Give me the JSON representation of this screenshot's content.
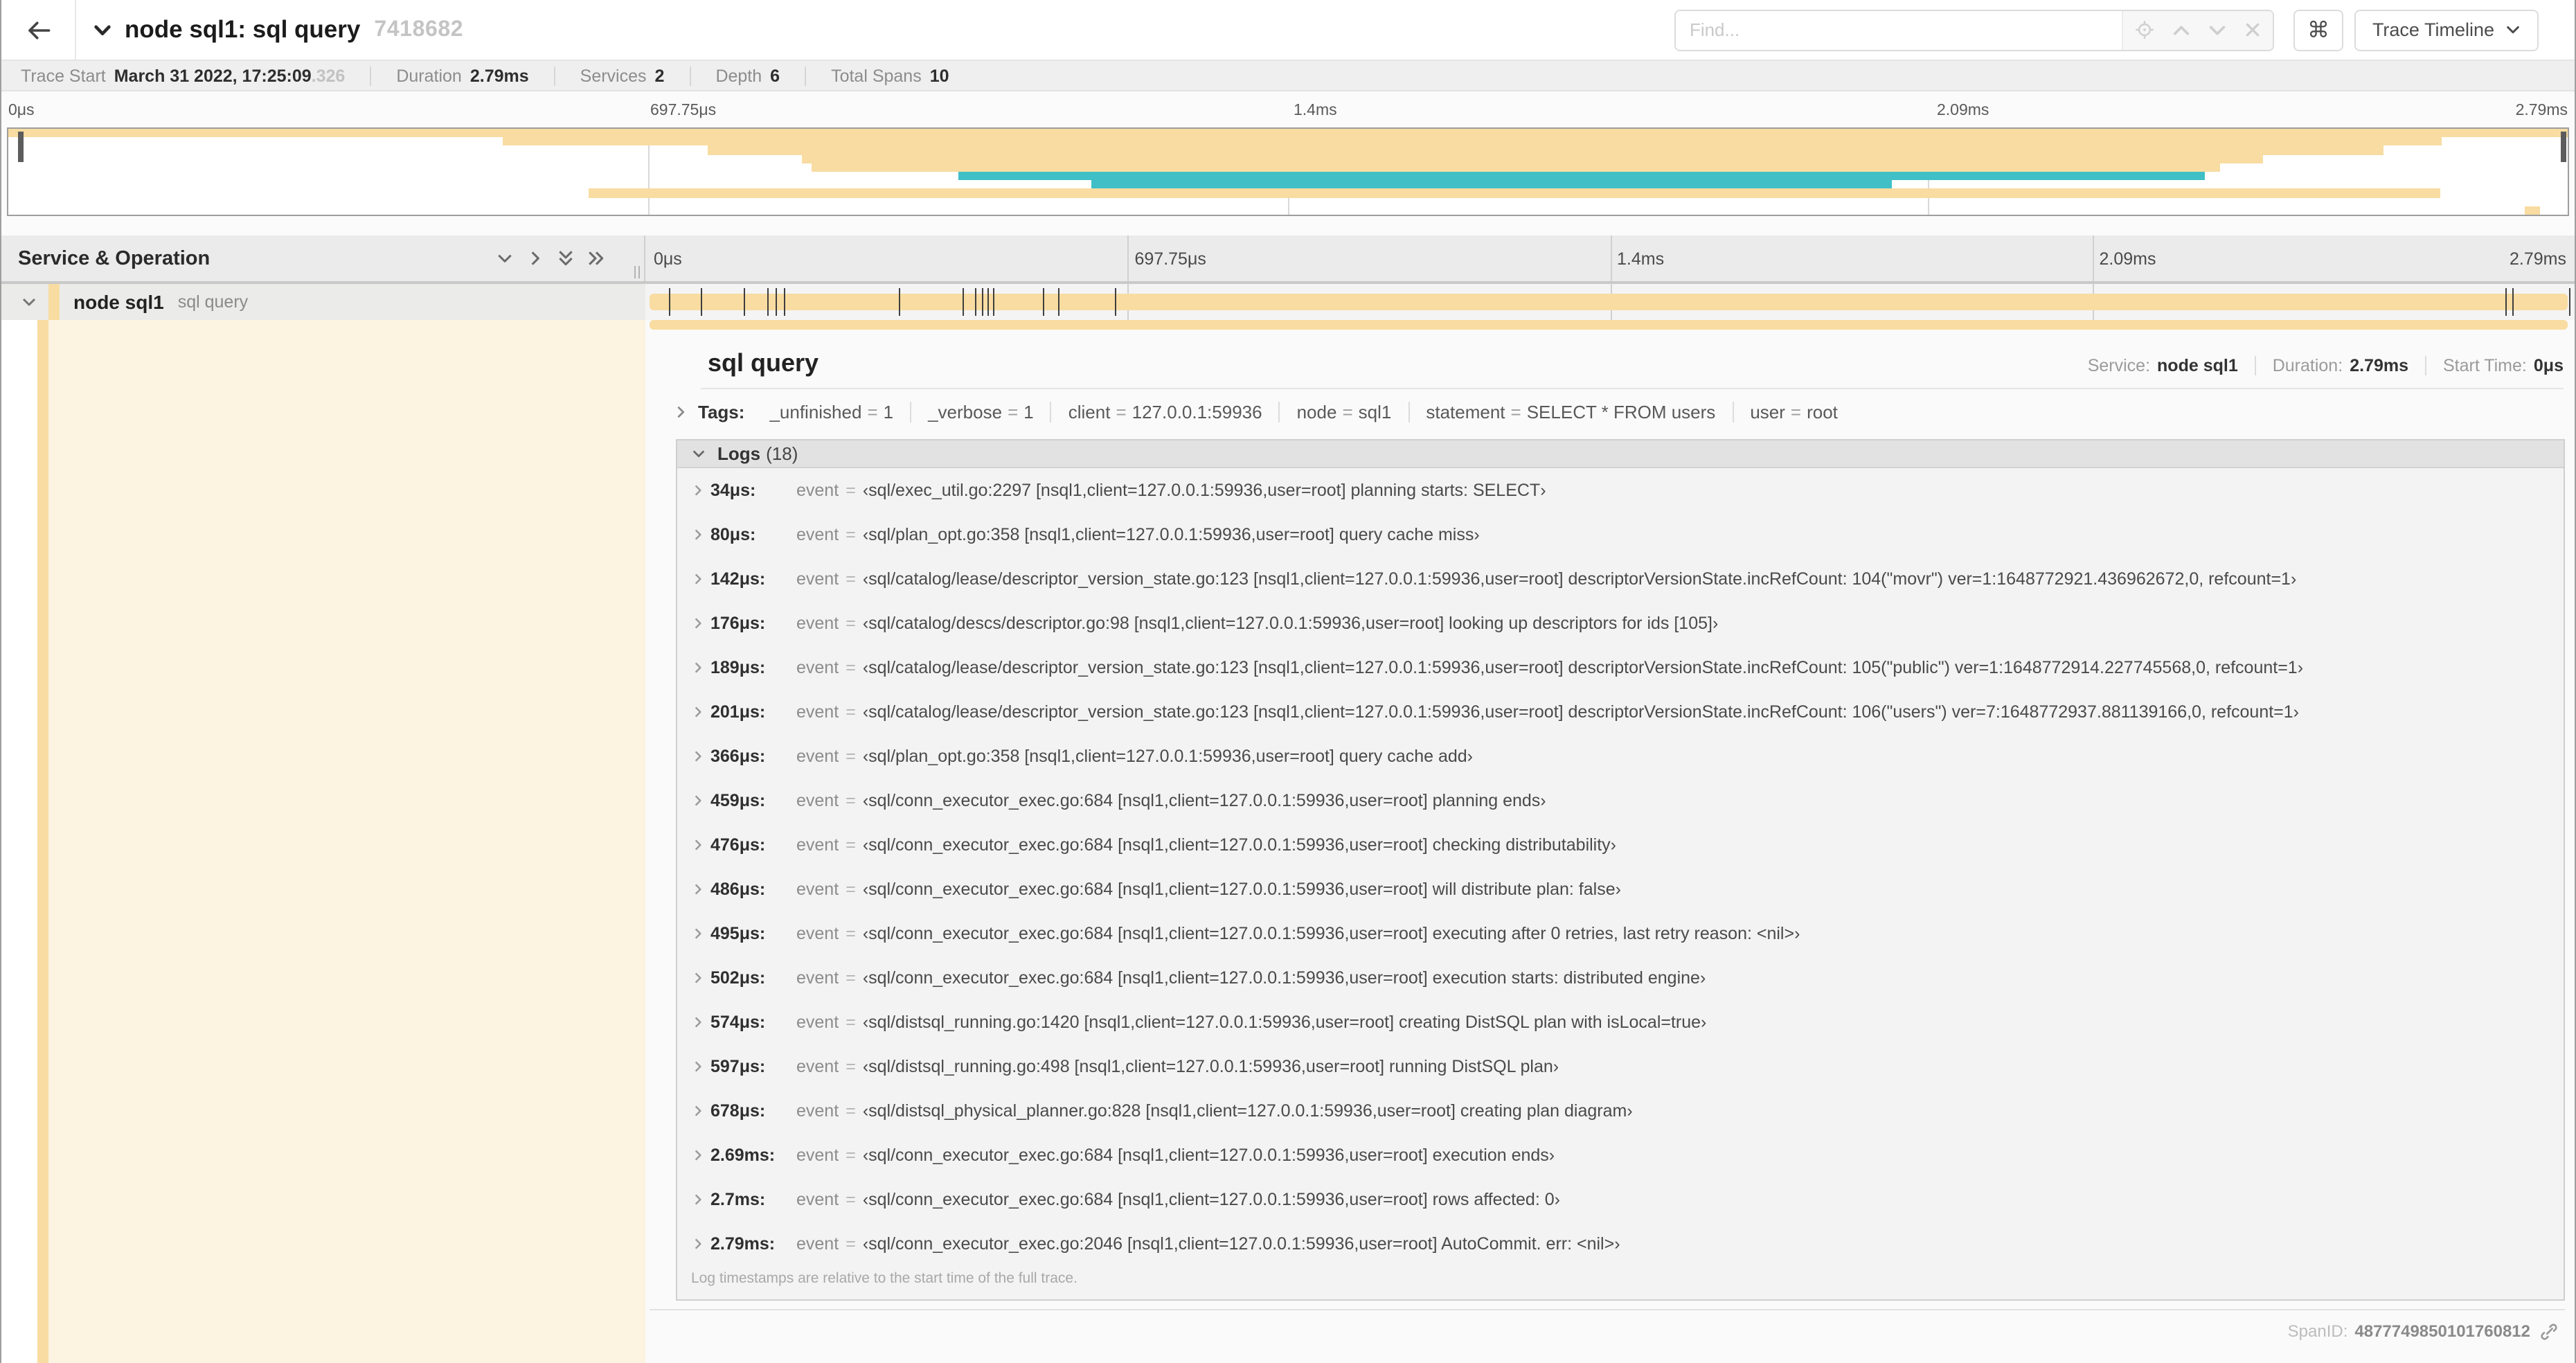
{
  "header": {
    "title": "node sql1: sql query",
    "trace_id": "7418682",
    "find_placeholder": "Find...",
    "shortcut_key": "⌘",
    "view_selector": "Trace Timeline"
  },
  "meta": {
    "items": [
      {
        "label": "Trace Start",
        "value": "March 31 2022, 17:25:09",
        "suffix": ".326"
      },
      {
        "label": "Duration",
        "value": "2.79ms"
      },
      {
        "label": "Services",
        "value": "2"
      },
      {
        "label": "Depth",
        "value": "6"
      },
      {
        "label": "Total Spans",
        "value": "10"
      }
    ]
  },
  "minimap": {
    "bars": [
      {
        "row": 0,
        "start": 0,
        "end": 100,
        "c": "tan"
      },
      {
        "row": 1,
        "start": 19.3,
        "end": 95.1,
        "c": "tan"
      },
      {
        "row": 2,
        "start": 27.3,
        "end": 92.8,
        "c": "tan"
      },
      {
        "row": 3,
        "start": 31.0,
        "end": 88.1,
        "c": "tan"
      },
      {
        "row": 4,
        "start": 31.4,
        "end": 86.4,
        "c": "tan"
      },
      {
        "row": 5,
        "start": 37.1,
        "end": 85.8,
        "c": "teal"
      },
      {
        "row": 6,
        "start": 42.3,
        "end": 73.6,
        "c": "teal"
      },
      {
        "row": 7,
        "start": 22.7,
        "end": 95.0,
        "c": "tan"
      },
      {
        "row": 9,
        "start": 98.3,
        "end": 98.9,
        "c": "tan"
      }
    ]
  },
  "timeline": {
    "ticks": [
      "0μs",
      "697.75μs",
      "1.4ms",
      "2.09ms",
      "2.79ms"
    ],
    "col_header": "Service & Operation",
    "row": {
      "service": "node sql1",
      "operation": "sql query"
    },
    "duration_us": 2790,
    "log_marker_times_us": [
      34,
      80,
      142,
      176,
      189,
      201,
      366,
      459,
      476,
      486,
      495,
      502,
      574,
      597,
      678,
      2690,
      2700,
      2786
    ]
  },
  "detail": {
    "title": "sql query",
    "summary": [
      {
        "label": "Service:",
        "value": "node sql1"
      },
      {
        "label": "Duration:",
        "value": "2.79ms"
      },
      {
        "label": "Start Time:",
        "value": "0μs"
      }
    ],
    "tags_label": "Tags:",
    "tags": [
      {
        "k": "_unfinished",
        "v": "1"
      },
      {
        "k": "_verbose",
        "v": "1"
      },
      {
        "k": "client",
        "v": "127.0.0.1:59936"
      },
      {
        "k": "node",
        "v": "sql1"
      },
      {
        "k": "statement",
        "v": "SELECT * FROM users"
      },
      {
        "k": "user",
        "v": "root"
      }
    ],
    "logs_label": "Logs",
    "logs_count": "(18)",
    "logs": [
      {
        "t": "34μs:",
        "k": "event",
        "v": "‹sql/exec_util.go:2297 [nsql1,client=127.0.0.1:59936,user=root] planning starts: SELECT›"
      },
      {
        "t": "80μs:",
        "k": "event",
        "v": "‹sql/plan_opt.go:358 [nsql1,client=127.0.0.1:59936,user=root] query cache miss›"
      },
      {
        "t": "142μs:",
        "k": "event",
        "v": "‹sql/catalog/lease/descriptor_version_state.go:123 [nsql1,client=127.0.0.1:59936,user=root] descriptorVersionState.incRefCount: 104(\"movr\") ver=1:1648772921.436962672,0, refcount=1›"
      },
      {
        "t": "176μs:",
        "k": "event",
        "v": "‹sql/catalog/descs/descriptor.go:98 [nsql1,client=127.0.0.1:59936,user=root] looking up descriptors for ids [105]›"
      },
      {
        "t": "189μs:",
        "k": "event",
        "v": "‹sql/catalog/lease/descriptor_version_state.go:123 [nsql1,client=127.0.0.1:59936,user=root] descriptorVersionState.incRefCount: 105(\"public\") ver=1:1648772914.227745568,0, refcount=1›"
      },
      {
        "t": "201μs:",
        "k": "event",
        "v": "‹sql/catalog/lease/descriptor_version_state.go:123 [nsql1,client=127.0.0.1:59936,user=root] descriptorVersionState.incRefCount: 106(\"users\") ver=7:1648772937.881139166,0, refcount=1›"
      },
      {
        "t": "366μs:",
        "k": "event",
        "v": "‹sql/plan_opt.go:358 [nsql1,client=127.0.0.1:59936,user=root] query cache add›"
      },
      {
        "t": "459μs:",
        "k": "event",
        "v": "‹sql/conn_executor_exec.go:684 [nsql1,client=127.0.0.1:59936,user=root] planning ends›"
      },
      {
        "t": "476μs:",
        "k": "event",
        "v": "‹sql/conn_executor_exec.go:684 [nsql1,client=127.0.0.1:59936,user=root] checking distributability›"
      },
      {
        "t": "486μs:",
        "k": "event",
        "v": "‹sql/conn_executor_exec.go:684 [nsql1,client=127.0.0.1:59936,user=root] will distribute plan: false›"
      },
      {
        "t": "495μs:",
        "k": "event",
        "v": "‹sql/conn_executor_exec.go:684 [nsql1,client=127.0.0.1:59936,user=root] executing after 0 retries, last retry reason: <nil>›"
      },
      {
        "t": "502μs:",
        "k": "event",
        "v": "‹sql/conn_executor_exec.go:684 [nsql1,client=127.0.0.1:59936,user=root] execution starts: distributed engine›"
      },
      {
        "t": "574μs:",
        "k": "event",
        "v": "‹sql/distsql_running.go:1420 [nsql1,client=127.0.0.1:59936,user=root] creating DistSQL plan with isLocal=true›"
      },
      {
        "t": "597μs:",
        "k": "event",
        "v": "‹sql/distsql_running.go:498 [nsql1,client=127.0.0.1:59936,user=root] running DistSQL plan›"
      },
      {
        "t": "678μs:",
        "k": "event",
        "v": "‹sql/distsql_physical_planner.go:828 [nsql1,client=127.0.0.1:59936,user=root] creating plan diagram›"
      },
      {
        "t": "2.69ms:",
        "k": "event",
        "v": "‹sql/conn_executor_exec.go:684 [nsql1,client=127.0.0.1:59936,user=root] execution ends›"
      },
      {
        "t": "2.7ms:",
        "k": "event",
        "v": "‹sql/conn_executor_exec.go:684 [nsql1,client=127.0.0.1:59936,user=root] rows affected: 0›"
      },
      {
        "t": "2.79ms:",
        "k": "event",
        "v": "‹sql/conn_executor_exec.go:2046 [nsql1,client=127.0.0.1:59936,user=root] AutoCommit. err: <nil>›"
      }
    ],
    "note": "Log timestamps are relative to the start time of the full trace.",
    "span_id_label": "SpanID:",
    "span_id": "4877749850101760812"
  },
  "colors": {
    "span_tan": "#F8DCA1",
    "span_teal": "#41BFC6",
    "detail_cream": "#FCF3E0"
  }
}
